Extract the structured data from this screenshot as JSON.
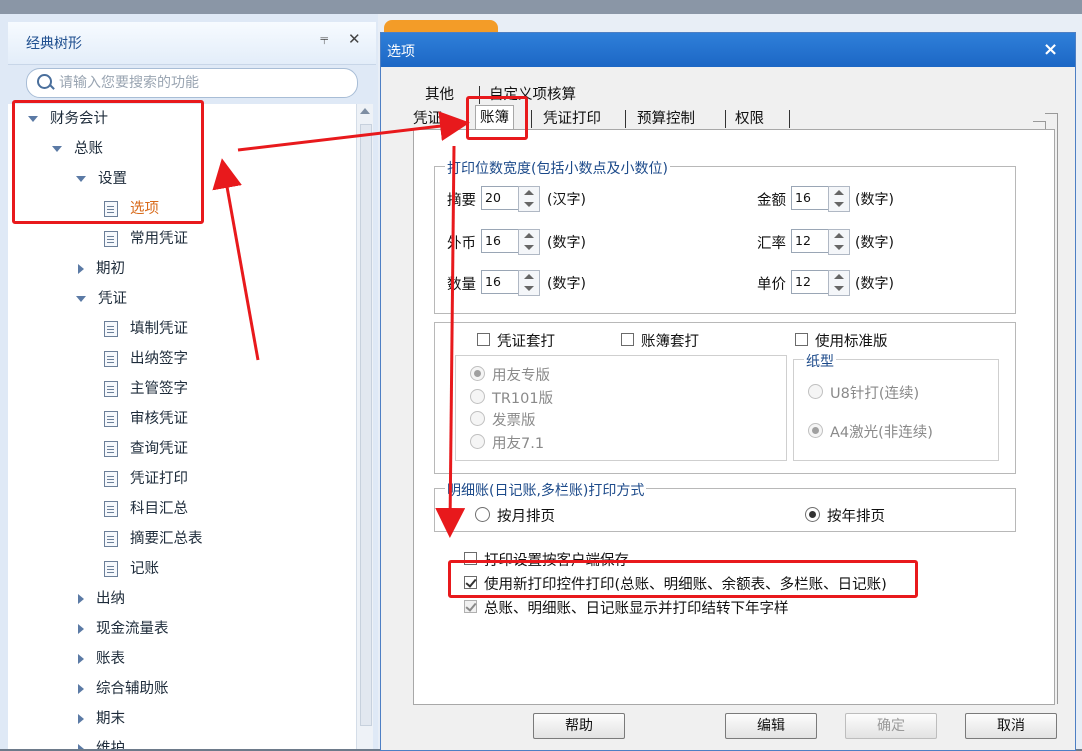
{
  "left_panel": {
    "title": "经典树形",
    "pin_glyph": "📌",
    "close_glyph": "✕",
    "search_placeholder": "请输入您要搜索的功能",
    "tree": [
      {
        "label": "财务会计"
      },
      {
        "label": "总账"
      },
      {
        "label": "设置"
      },
      {
        "label": "选项"
      },
      {
        "label": "常用凭证"
      },
      {
        "label": "期初"
      },
      {
        "label": "凭证"
      },
      {
        "label": "填制凭证"
      },
      {
        "label": "出纳签字"
      },
      {
        "label": "主管签字"
      },
      {
        "label": "审核凭证"
      },
      {
        "label": "查询凭证"
      },
      {
        "label": "凭证打印"
      },
      {
        "label": "科目汇总"
      },
      {
        "label": "摘要汇总表"
      },
      {
        "label": "记账"
      },
      {
        "label": "出纳"
      },
      {
        "label": "现金流量表"
      },
      {
        "label": "账表"
      },
      {
        "label": "综合辅助账"
      },
      {
        "label": "期末"
      },
      {
        "label": "维护"
      }
    ]
  },
  "dialog": {
    "title": "选项",
    "close_glyph": "×",
    "tabs_row1": [
      "其他",
      "自定义项核算"
    ],
    "tabs_row2": [
      "凭证",
      "账簿",
      "凭证打印",
      "预算控制",
      "权限"
    ],
    "width_group": {
      "legend": "打印位数宽度(包括小数点及小数位)",
      "rows": [
        {
          "label": "摘要",
          "value": "20",
          "unit": "(汉字)"
        },
        {
          "label": "外币",
          "value": "16",
          "unit": "(数字)"
        },
        {
          "label": "数量",
          "value": "16",
          "unit": "(数字)"
        },
        {
          "label": "金额",
          "value": "16",
          "unit": "(数字)"
        },
        {
          "label": "汇率",
          "value": "12",
          "unit": "(数字)"
        },
        {
          "label": "单价",
          "value": "12",
          "unit": "(数字)"
        }
      ]
    },
    "print_group": {
      "cb_voucher": "凭证套打",
      "cb_book": "账簿套打",
      "cb_standard": "使用标准版",
      "radios": [
        "用友专版",
        "TR101版",
        "发票版",
        "用友7.1"
      ],
      "paper_legend": "纸型",
      "paper_radios": [
        "U8针打(连续)",
        "A4激光(非连续)"
      ]
    },
    "detail_group": {
      "legend": "明细账(日记账,多栏账)打印方式",
      "by_month": "按月排页",
      "by_year": "按年排页"
    },
    "checkboxes": [
      "打印设置按客户端保存",
      "使用新打印控件打印(总账、明细账、余额表、多栏账、日记账)",
      "总账、明细账、日记账显示并打印结转下年字样"
    ],
    "buttons": {
      "help": "帮助",
      "edit": "编辑",
      "ok": "确定",
      "cancel": "取消"
    }
  }
}
